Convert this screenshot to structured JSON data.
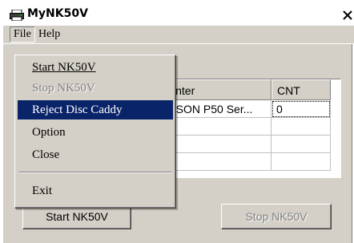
{
  "window": {
    "title": "MyNK50V",
    "close_glyph": "X"
  },
  "menubar": {
    "file": "File",
    "help": "Help"
  },
  "file_menu": {
    "items": [
      {
        "label": "Start NK50V",
        "enabled": true,
        "selected": false
      },
      {
        "label": "Stop NK50V",
        "enabled": false,
        "selected": false
      },
      {
        "label": "Reject Disc Caddy",
        "enabled": true,
        "selected": true
      },
      {
        "label": "Option",
        "enabled": true,
        "selected": false
      },
      {
        "label": "Close",
        "enabled": true,
        "selected": false
      },
      {
        "label": "Exit",
        "enabled": true,
        "selected": false
      }
    ]
  },
  "printer_list": {
    "columns": [
      "Printer",
      "CNT"
    ],
    "rows": [
      {
        "printer": "EPSON P50 Ser...",
        "cnt": "0"
      },
      {
        "printer": "",
        "cnt": ""
      },
      {
        "printer": "",
        "cnt": ""
      },
      {
        "printer": "",
        "cnt": ""
      }
    ]
  },
  "buttons": {
    "start": "Start NK50V",
    "stop": "Stop NK50V"
  },
  "icons": {
    "app": "printer-icon",
    "close": "close-icon"
  },
  "colors": {
    "face": "#d4d0c8",
    "highlight": "#0a246a",
    "disabled_text": "#808080"
  }
}
